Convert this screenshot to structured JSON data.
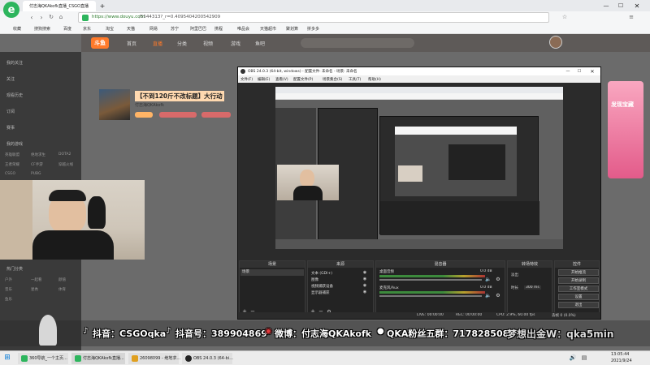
{
  "browser": {
    "tab_title": "付志海QKAkofk直播_CSGO直播",
    "url_host": "https://www.douyu.com",
    "url_path": "/5544313?_r=0.40954042005429​09",
    "bookmarks": [
      "收藏",
      "搜狗搜索",
      "百度",
      "京东",
      "淘宝",
      "天猫",
      "网易",
      "苏宁",
      "阿里巴巴",
      "携程",
      "唯品会",
      "天猫超市",
      "聚划算",
      "拼多多"
    ]
  },
  "site": {
    "nav": [
      "首页",
      "直播",
      "分类",
      "视频",
      "游戏",
      "鱼吧"
    ],
    "room_title": "【不到120斤不改标题】大行动",
    "streamer": "付志海QKAkofk",
    "sidebar_items": [
      "我的关注",
      "关注",
      "观看历史",
      "订阅",
      "赛事",
      "我的游戏",
      "热门分类"
    ],
    "sidebar_games": [
      "英雄联盟",
      "绝地求生",
      "DOTA2",
      "王者荣耀",
      "CF手游",
      "穿越火线",
      "CSGO",
      "PUBG",
      "户外",
      "一起看",
      "颜值",
      "音乐",
      "星秀",
      "体育",
      "鱼乐"
    ],
    "promo": "发现宝藏"
  },
  "obs": {
    "title": "OBS 24.0.3 (64-bit, windows) - 配置文件: 未命名 - 场景: 未命名",
    "menu": [
      "文件(F)",
      "编辑(E)",
      "查看(V)",
      "配置文件(P)",
      "场景集合(S)",
      "工具(T)",
      "帮助(H)"
    ],
    "docks": {
      "scenes": "场景",
      "sources": "来源",
      "mixer": "混音器",
      "transitions": "转场特效",
      "controls": "控件"
    },
    "scene_item": "场景",
    "sources": [
      "文本 (GDI+)",
      "图像",
      "视频捕获设备",
      "显示器捕获"
    ],
    "mixer_tracks": [
      {
        "name": "桌面音频",
        "db": "0.0 dB"
      },
      {
        "name": "麦克风/Aux",
        "db": "0.0 dB"
      }
    ],
    "transition": {
      "type": "淡出",
      "duration_label": "时长",
      "duration": "300 ms"
    },
    "controls": [
      "开始推流",
      "开始录制",
      "工作室模式",
      "设置",
      "退出"
    ],
    "status": {
      "live": "LIVE: 00:00:00",
      "rec": "REC: 00:00:00",
      "cpu": "CPU: 2.9%, 60.00 fps",
      "dropped": "丢帧 0 (0.0%)"
    }
  },
  "overlay": {
    "douyin1": "抖音：CSGOqka",
    "douyin2": "抖音号：389904869",
    "weibo": "微博：付志海QKAkofk",
    "group": "QKA粉丝五群：717828508",
    "wechat": "梦想出金W：qka5min"
  },
  "taskbar": {
    "items": [
      "360导航_一个主页...",
      "付志海QKAkofk直播...",
      "26098099 - 绝地求...",
      "OBS 24.0.3 (64-bi..."
    ],
    "time": "13:05:44",
    "date": "2021/9/24"
  },
  "colors": {
    "accent": "#ff5d23",
    "obs_bg": "#2b2b2b",
    "taskbar": "#ececec"
  }
}
